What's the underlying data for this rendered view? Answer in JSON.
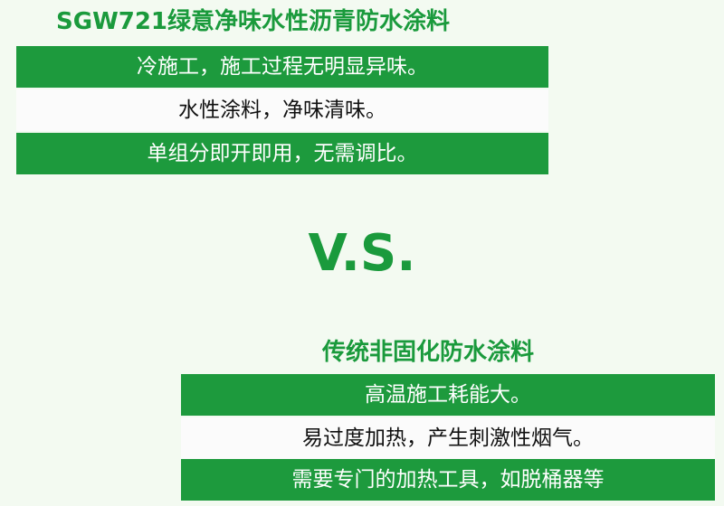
{
  "top": {
    "title": "SGW721绿意净味水性沥青防水涂料",
    "rows": [
      "冷施工，施工过程无明显异味。",
      "水性涂料，净味清味。",
      "单组分即开即用，无需调比。"
    ]
  },
  "vs_label": "V.S.",
  "bottom": {
    "title": "传统非固化防水涂料",
    "rows": [
      "高温施工耗能大。",
      "易过度加热，产生刺激性烟气。",
      "需要专门的加热工具，如脱桶器等"
    ]
  },
  "colors": {
    "accent_green": "#1d9a3d",
    "background": "#f3faf1",
    "row_light": "#fbfbfb"
  }
}
